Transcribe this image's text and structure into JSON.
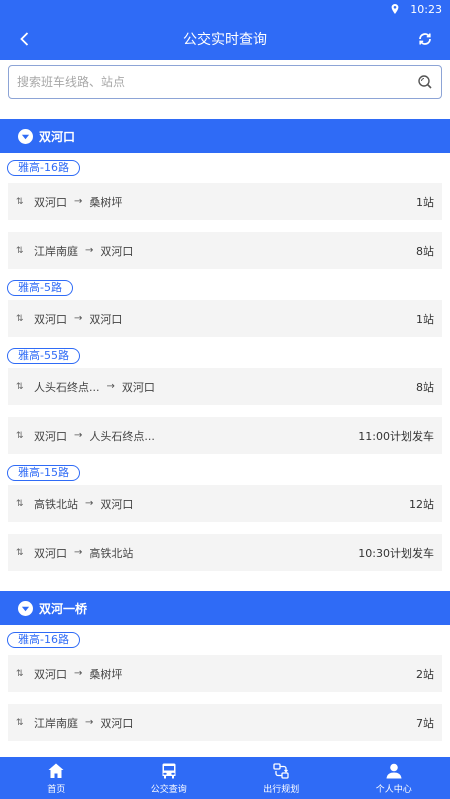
{
  "status_bar": {
    "time": "10:23",
    "icons": [
      "location-icon"
    ]
  },
  "header": {
    "title": "公交实时查询",
    "back_icon": "chevron-left-icon",
    "refresh_icon": "refresh-icon"
  },
  "search": {
    "placeholder": "搜索班车线路、站点",
    "icon": "search-icon"
  },
  "stops": [
    {
      "name": "双河口",
      "routes": [
        {
          "tag": "雅高-16路",
          "directions": [
            {
              "from": "双河口",
              "to": "桑树坪",
              "info": "1站"
            },
            {
              "from": "江岸南庭",
              "to": "双河口",
              "info": "8站"
            }
          ]
        },
        {
          "tag": "雅高-5路",
          "directions": [
            {
              "from": "双河口",
              "to": "双河口",
              "info": "1站"
            }
          ]
        },
        {
          "tag": "雅高-55路",
          "directions": [
            {
              "from": "人头石终点...",
              "to": "双河口",
              "info": "8站"
            },
            {
              "from": "双河口",
              "to": "人头石终点...",
              "info": "11:00计划发车"
            }
          ]
        },
        {
          "tag": "雅高-15路",
          "directions": [
            {
              "from": "高铁北站",
              "to": "双河口",
              "info": "12站"
            },
            {
              "from": "双河口",
              "to": "高铁北站",
              "info": "10:30计划发车"
            }
          ]
        }
      ]
    },
    {
      "name": "双河一桥",
      "routes": [
        {
          "tag": "雅高-16路",
          "directions": [
            {
              "from": "双河口",
              "to": "桑树坪",
              "info": "2站"
            },
            {
              "from": "江岸南庭",
              "to": "双河口",
              "info": "7站"
            }
          ]
        }
      ]
    }
  ],
  "tabbar": [
    {
      "label": "首页",
      "icon": "home-icon"
    },
    {
      "label": "公交查询",
      "icon": "bus-icon"
    },
    {
      "label": "出行规划",
      "icon": "route-plan-icon"
    },
    {
      "label": "个人中心",
      "icon": "person-icon"
    }
  ],
  "colors": {
    "primary": "#2f6bf6",
    "row_bg": "#f4f4f4"
  }
}
